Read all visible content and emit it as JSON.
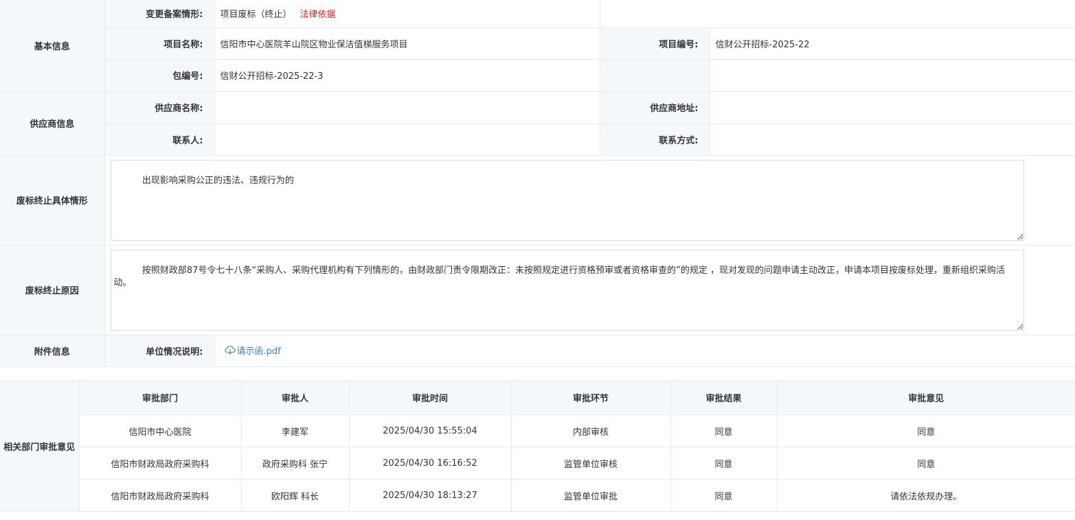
{
  "basic": {
    "section_label": "基本信息",
    "change_type_label": "变更备案情形:",
    "change_type_value": "项目废标（终止）",
    "legal_basis_link": "法律依据",
    "project_name_label": "项目名称:",
    "project_name_value": "信阳市中心医院羊山院区物业保洁值梯服务项目",
    "project_no_label": "项目编号:",
    "project_no_value": "信财公开招标-2025-22",
    "package_no_label": "包编号:",
    "package_no_value": "信财公开招标-2025-22-3"
  },
  "supplier": {
    "section_label": "供应商信息",
    "name_label": "供应商名称:",
    "name_value": "",
    "address_label": "供应商地址:",
    "address_value": "",
    "contact_label": "联系人:",
    "contact_value": "",
    "phone_label": "联系方式:",
    "phone_value": ""
  },
  "termination_detail": {
    "section_label": "废标终止具体情形",
    "text": "出现影响采购公正的违法、违规行为的"
  },
  "termination_reason": {
    "section_label": "废标终止原因",
    "text": "按照财政部87号令七十八条“采购人、采购代理机构有下列情形的，由财政部门责令限期改正：未按照规定进行资格预审或者资格审查的”的规定 ，现对发现的问题申请主动改正，申请本项目按废标处理，重新组织采购活动。"
  },
  "attachment": {
    "section_label": "附件信息",
    "unit_desc_label": "单位情况说明:",
    "file_name": "请示函.pdf",
    "icon": "cloud-download-icon"
  },
  "approval": {
    "section_label": "相关部门审批意见",
    "columns": [
      "审批部门",
      "审批人",
      "审批时间",
      "审批环节",
      "审批结果",
      "审批意见"
    ],
    "rows": [
      [
        "信阳市中心医院",
        "李建军",
        "2025/04/30 15:55:04",
        "内部审核",
        "同意",
        "同意"
      ],
      [
        "信阳市财政局政府采购科",
        "政府采购科 张宁",
        "2025/04/30 16:16:52",
        "监管单位审核",
        "同意",
        "同意"
      ],
      [
        "信阳市财政局政府采购科",
        "欧阳辉 科长",
        "2025/04/30 18:13:27",
        "监管单位审批",
        "同意",
        "请依法依规办理。"
      ]
    ]
  },
  "colors": {
    "label_bg": "#f5f8fb",
    "border": "#e6ebf0",
    "link_red": "#e02020",
    "link_blue": "#3b7ec2"
  }
}
